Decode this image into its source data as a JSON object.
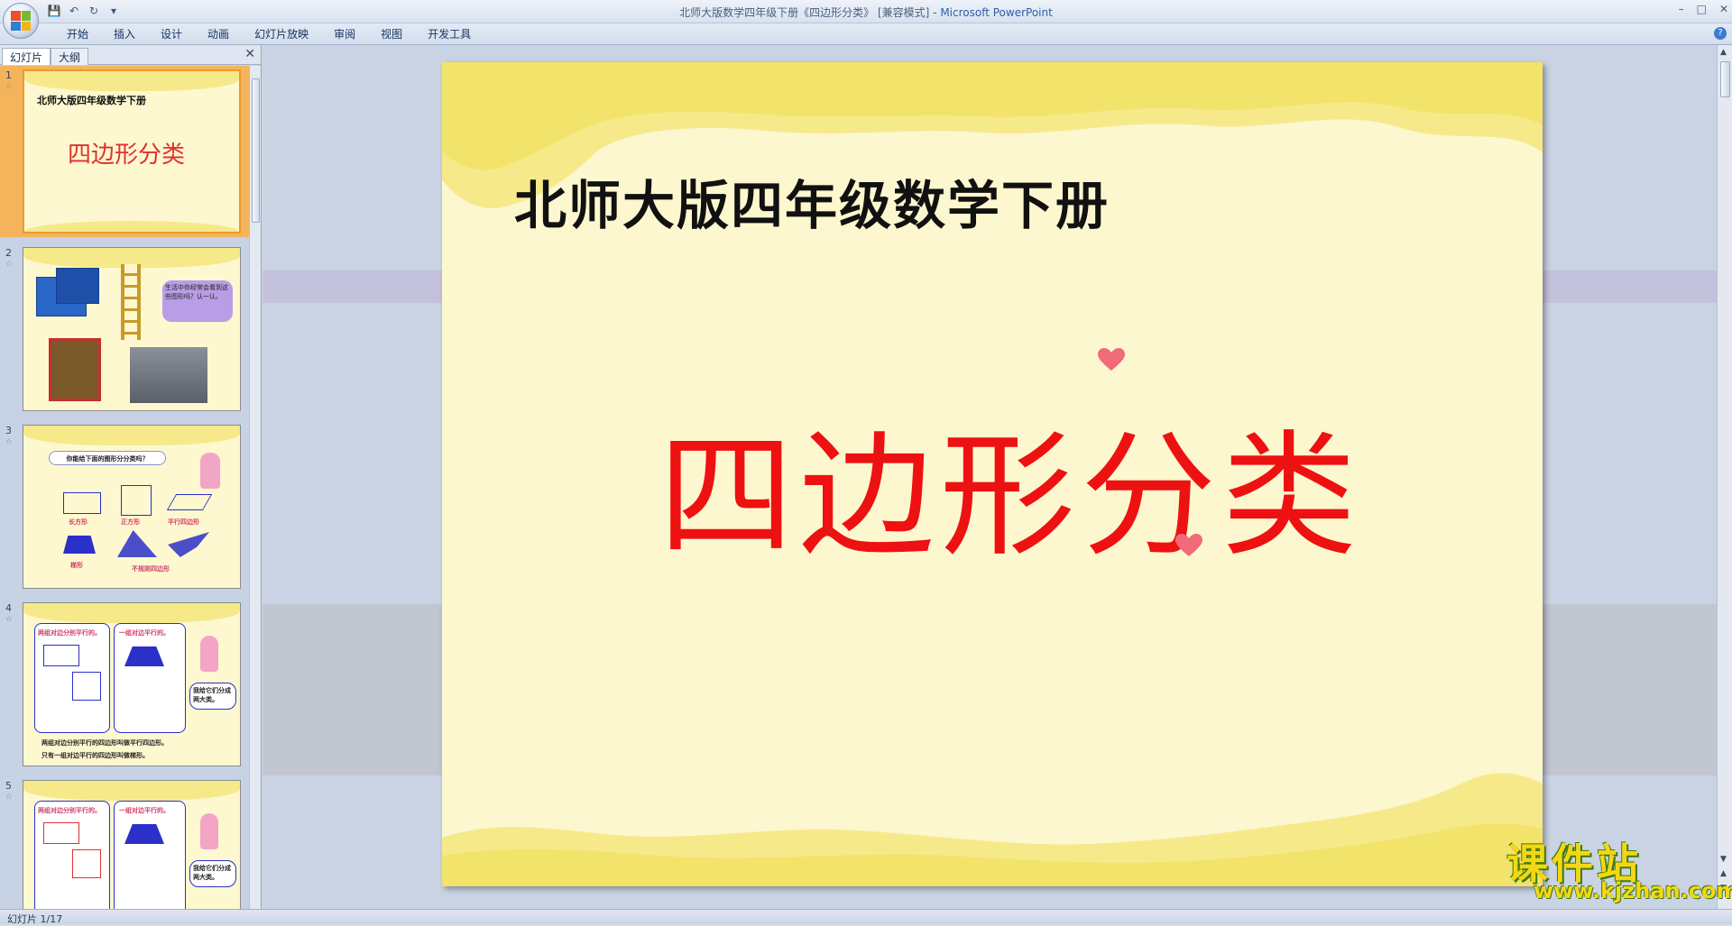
{
  "window": {
    "title_prefix": "北师大版数学四年级下册《四边形分类》 [兼容模式] - ",
    "app_name": "Microsoft PowerPoint"
  },
  "ribbon": {
    "tabs": [
      "开始",
      "插入",
      "设计",
      "动画",
      "幻灯片放映",
      "审阅",
      "视图",
      "开发工具"
    ]
  },
  "panel": {
    "tab_slides": "幻灯片",
    "tab_outline": "大纲"
  },
  "thumbnails": [
    {
      "num": "1",
      "title": "北师大版四年级数学下册",
      "subtitle": "四边形分类"
    },
    {
      "num": "2",
      "bubble": "生活中你经常会看到这些图形吗？认一认。"
    },
    {
      "num": "3",
      "cloud": "你能给下面的图形分分类吗？",
      "labels": [
        "长方形",
        "正方形",
        "平行四边形",
        "梯形",
        "不规则四边形"
      ]
    },
    {
      "num": "4",
      "box1": "两组对边分别平行的。",
      "box2": "一组对边平行的。",
      "bubble": "我给它们分成两大类。",
      "line1": "两组对边分别平行的四边形叫做平行四边形。",
      "line2": "只有一组对边平行的四边形叫做梯形。"
    },
    {
      "num": "5",
      "box1": "两组对边分别平行的。",
      "box2": "一组对边平行的。",
      "bubble": "我给它们分成两大类。"
    }
  ],
  "slide": {
    "title": "北师大版四年级数学下册",
    "main": "四边形分类"
  },
  "status": {
    "slide_count": "幻灯片 1/17"
  },
  "watermark": {
    "line1": "课件站",
    "line2": "www.kjzhan.com"
  },
  "colors": {
    "slide_bg": "#fdf7cf",
    "slide_wave": "#f6e98a",
    "main_text": "#ee1111",
    "selection": "#f4b45c"
  }
}
